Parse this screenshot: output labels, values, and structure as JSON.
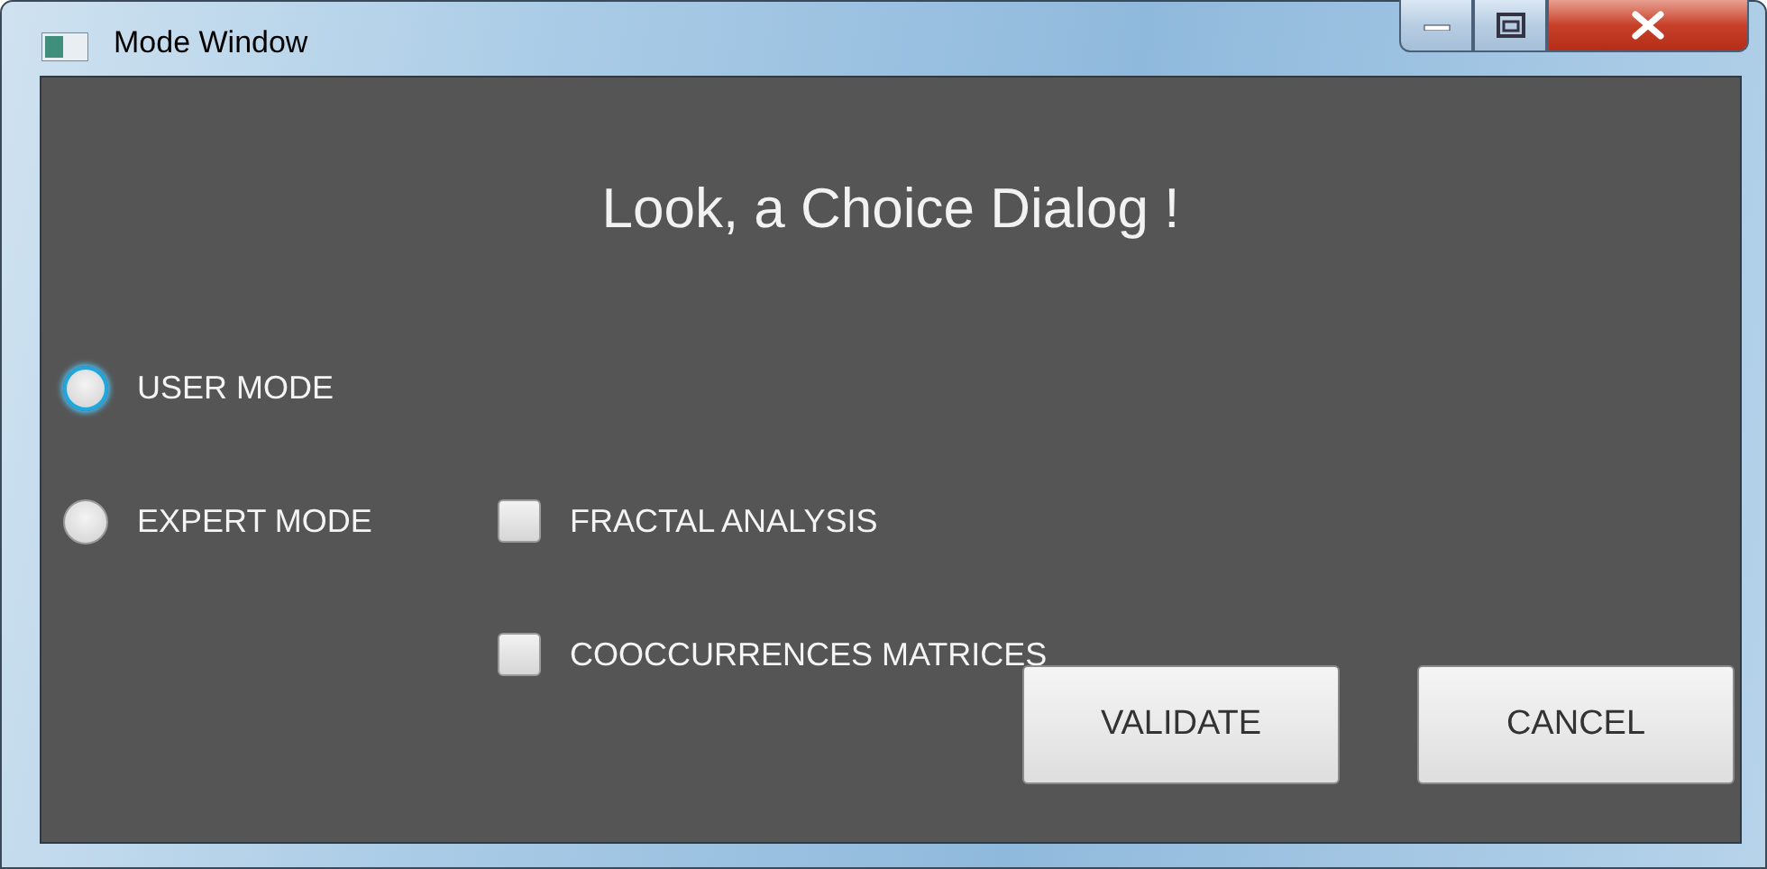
{
  "window": {
    "title": "Mode Window"
  },
  "heading": "Look, a Choice Dialog !",
  "modes": [
    {
      "label": "USER MODE",
      "selected": false,
      "focused": true
    },
    {
      "label": "EXPERT MODE",
      "selected": false,
      "focused": false
    }
  ],
  "analyses": [
    {
      "label": "FRACTAL ANALYSIS",
      "checked": false
    },
    {
      "label": "COOCCURRENCES MATRICES",
      "checked": false
    }
  ],
  "buttons": [
    "VALIDATE",
    "CANCEL"
  ]
}
